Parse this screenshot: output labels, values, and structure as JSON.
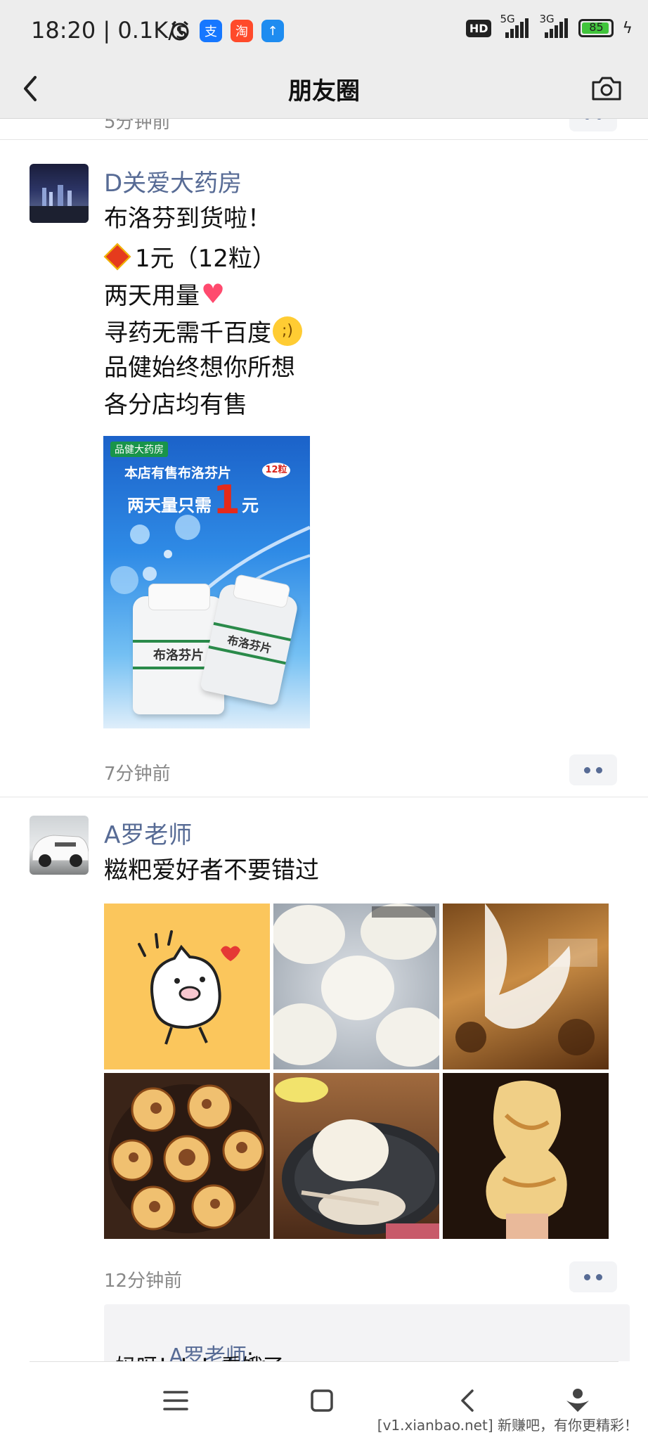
{
  "status": {
    "time": "18:20 | 0.1K/s",
    "hd": "HD",
    "net1": "5G",
    "net2": "3G",
    "battery": "85"
  },
  "header": {
    "title": "朋友圈"
  },
  "cropped_post": {
    "time": "5分钟前"
  },
  "posts": [
    {
      "name": "D关爱大药房",
      "lines": [
        "布洛芬到货啦！",
        "1元（12粒）",
        "两天用量",
        "寻药无需千百度",
        "品健始终想你所想",
        "各分店均有售"
      ],
      "poster": {
        "brand": "品健大药房",
        "line1": "本店有售布洛芬片",
        "badge": "12粒",
        "line2a": "两天量只需",
        "big": "1",
        "line2b": "元",
        "bottle": "布洛芬片"
      },
      "time": "7分钟前"
    },
    {
      "name": "A罗老师",
      "lines": [
        "糍粑爱好者不要错过"
      ],
      "time": "12分钟前",
      "comment": {
        "author": "A罗老师",
        "sep": ": .",
        "text": "妈呀！！！看饿了"
      }
    }
  ],
  "watermark": "[v1.xianbao.net] 新赚吧，有你更精彩！"
}
